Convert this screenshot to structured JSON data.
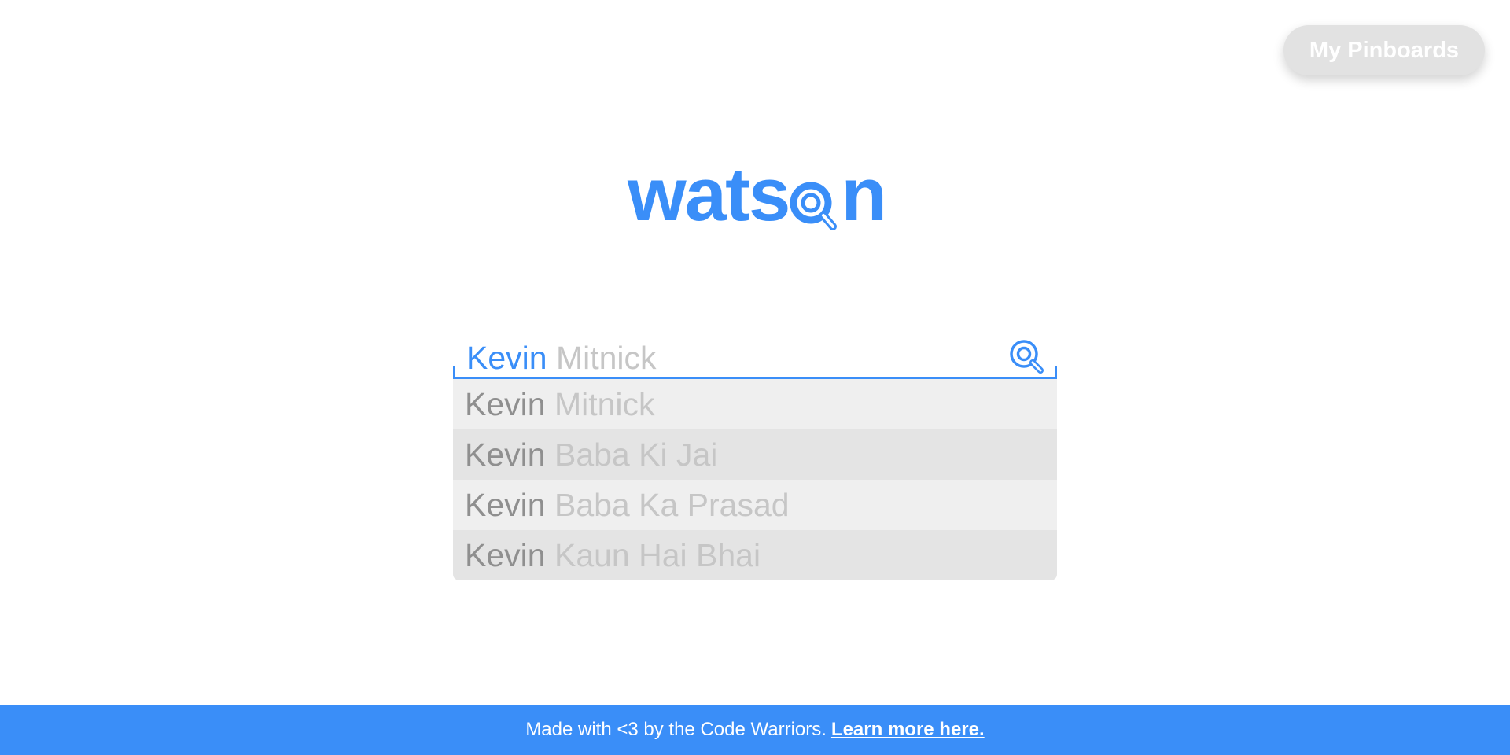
{
  "header": {
    "pinboards_label": "My Pinboards"
  },
  "logo": {
    "text_prefix": "wats",
    "text_suffix": "n",
    "icon": "magnifier-o-icon",
    "color": "#3a8ef8"
  },
  "search": {
    "typed_value": "Kevin",
    "ghost_completion": "Mitnick",
    "icon": "search-icon",
    "accent": "#3a8ef8"
  },
  "suggestions": [
    {
      "first": "Kevin",
      "rest": "Mitnick"
    },
    {
      "first": "Kevin",
      "rest": "Baba Ki Jai"
    },
    {
      "first": "Kevin",
      "rest": "Baba Ka Prasad"
    },
    {
      "first": "Kevin",
      "rest": "Kaun Hai Bhai"
    }
  ],
  "footer": {
    "text": "Made with <3 by the Code Warriors.",
    "link_label": "Learn more here.",
    "background": "#3a8ef8"
  }
}
